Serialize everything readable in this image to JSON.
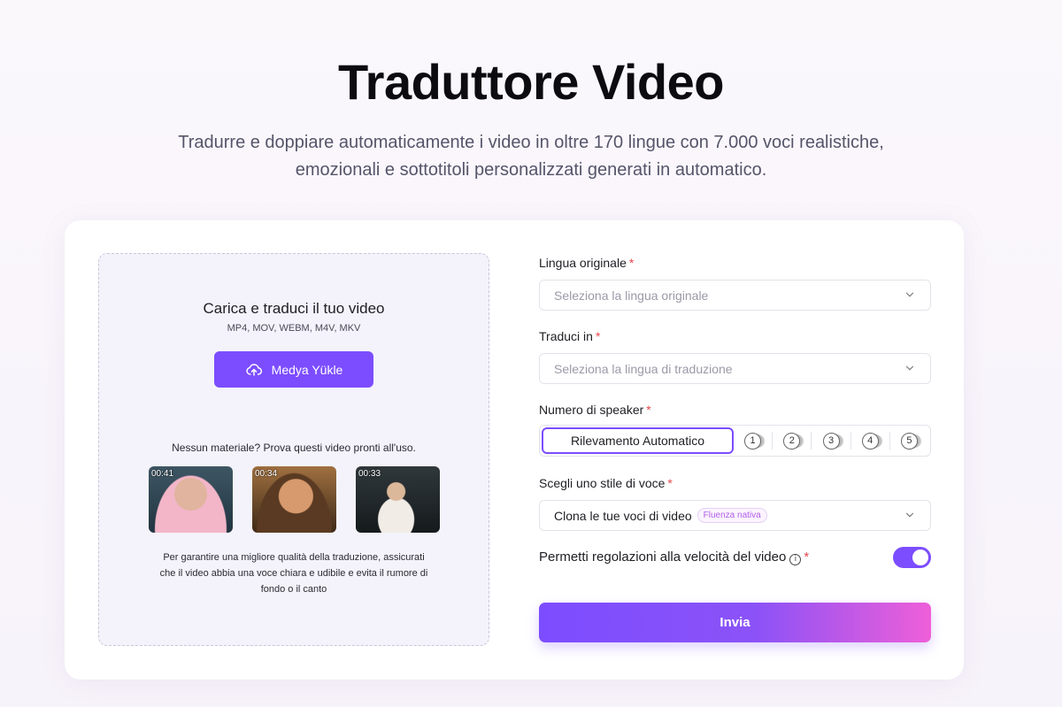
{
  "header": {
    "title": "Traduttore Video",
    "subtitle_line1": "Tradurre e doppiare automaticamente i video in oltre 170 lingue con 7.000 voci realistiche,",
    "subtitle_line2": "emozionali e sottotitoli personalizzati generati in automatico."
  },
  "upload": {
    "title": "Carica e traduci il tuo video",
    "formats": "MP4, MOV, WEBM, M4V, MKV",
    "button_label": "Medya Yükle",
    "samples_hint": "Nessun materiale? Prova questi video pronti all'uso.",
    "samples": [
      {
        "duration": "00:41"
      },
      {
        "duration": "00:34"
      },
      {
        "duration": "00:33"
      }
    ],
    "quality_note_line1": "Per garantire una migliore qualità della traduzione, assicurati",
    "quality_note_line2": "che il video abbia una voce chiara e udibile e evita il rumore di",
    "quality_note_line3": "fondo o il canto"
  },
  "form": {
    "source_language": {
      "label": "Lingua originale",
      "required": "*",
      "placeholder": "Seleziona la lingua originale"
    },
    "target_language": {
      "label": "Traduci in",
      "required": "*",
      "placeholder": "Seleziona la lingua di traduzione"
    },
    "speakers": {
      "label": "Numero di speaker",
      "required": "*",
      "auto_label": "Rilevamento Automatico",
      "options": [
        "1",
        "2",
        "3",
        "4",
        "5"
      ],
      "selected": "Rilevamento Automatico"
    },
    "voice_style": {
      "label": "Scegli uno stile di voce",
      "required": "*",
      "value": "Clona le tue voci di video",
      "badge": "Fluenza nativa"
    },
    "speed": {
      "label": "Permetti regolazioni alla velocità del video",
      "info_icon": "i",
      "required": "*",
      "enabled": true
    },
    "submit_label": "Invia"
  },
  "colors": {
    "accent": "#7c4dff",
    "gradient_end": "#ee5fd8",
    "required": "#e5484d"
  }
}
